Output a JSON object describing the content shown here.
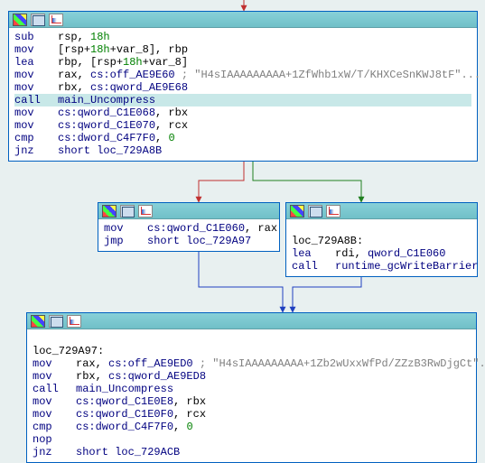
{
  "nodes": {
    "b1": {
      "rows": [
        {
          "mn": "sub",
          "ops": "rsp, ",
          "num": "18h",
          "rest": ""
        },
        {
          "mn": "mov",
          "ops": "[rsp+",
          "num": "18h",
          "rest": "+var_8], rbp"
        },
        {
          "mn": "lea",
          "ops": "rbp, [rsp+",
          "num": "18h",
          "rest": "+var_8]"
        },
        {
          "mn": "mov",
          "ops": "rax, ",
          "num": "",
          "rest": "cs:off_AE9E60",
          "cm": " ; \"H4sIAAAAAAAAA+1ZfWhb1xW/T/KHXCeSnKWJ8tF\"..."
        },
        {
          "mn": "mov",
          "ops": "rbx, ",
          "num": "",
          "rest": "cs:qword_AE9E68"
        },
        {
          "mn": "call",
          "ops": "",
          "num": "",
          "rest": "main_Uncompress",
          "hl": true,
          "fn": true
        },
        {
          "mn": "mov",
          "ops": "",
          "num": "",
          "rest": "cs:qword_C1E068, rbx"
        },
        {
          "mn": "mov",
          "ops": "",
          "num": "",
          "rest": "cs:qword_C1E070, rcx"
        },
        {
          "mn": "cmp",
          "ops": "",
          "num": "",
          "rest": "cs:dword_C4F7F0, 0",
          "numend": "0"
        },
        {
          "mn": "jnz",
          "ops": "",
          "num": "",
          "rest": "short loc_729A8B"
        }
      ]
    },
    "b2": {
      "rows": [
        {
          "mn": "mov",
          "ops": "",
          "rest": "cs:qword_C1E060, rax"
        },
        {
          "mn": "jmp",
          "ops": "",
          "rest": "short loc_729A97"
        }
      ]
    },
    "b3": {
      "label": "loc_729A8B:",
      "rows": [
        {
          "mn": "lea",
          "ops": "rdi, ",
          "rest": "qword_C1E060"
        },
        {
          "mn": "call",
          "ops": "",
          "rest": "runtime_gcWriteBarrier",
          "fn": true
        }
      ]
    },
    "b4": {
      "label": "loc_729A97:",
      "rows": [
        {
          "mn": "mov",
          "ops": "rax, ",
          "rest": "cs:off_AE9ED0",
          "cm": " ; \"H4sIAAAAAAAAA+1Zb2wUxxWfPd/ZZzB3RwDjgCt\"..."
        },
        {
          "mn": "mov",
          "ops": "rbx, ",
          "rest": "cs:qword_AE9ED8"
        },
        {
          "mn": "call",
          "ops": "",
          "rest": "main_Uncompress",
          "fn": true
        },
        {
          "mn": "mov",
          "ops": "",
          "rest": "cs:qword_C1E0E8, rbx"
        },
        {
          "mn": "mov",
          "ops": "",
          "rest": "cs:qword_C1E0F0, rcx"
        },
        {
          "mn": "cmp",
          "ops": "",
          "rest": "cs:dword_C4F7F0, 0",
          "numend": "0"
        },
        {
          "mn": "nop",
          "ops": "",
          "rest": ""
        },
        {
          "mn": "jnz",
          "ops": "",
          "rest": "short loc_729ACB"
        }
      ]
    }
  }
}
